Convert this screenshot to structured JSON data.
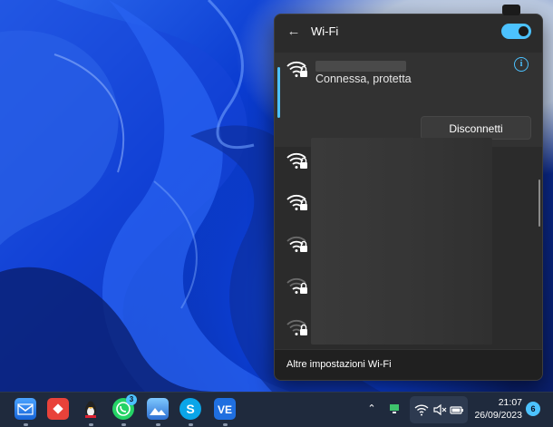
{
  "wifi_panel": {
    "title": "Wi-Fi",
    "toggle_state": "on",
    "connected_network": {
      "status": "Connessa, protetta",
      "action_label": "Disconnetti"
    },
    "available_networks_count": 5,
    "footer_link": "Altre impostazioni Wi-Fi"
  },
  "taskbar": {
    "apps": [
      {
        "name": "mail-app-icon"
      },
      {
        "name": "anydesk-app-icon"
      },
      {
        "name": "tux-app-icon"
      },
      {
        "name": "whatsapp-app-icon",
        "badge": "3"
      },
      {
        "name": "photos-app-icon"
      },
      {
        "name": "skype-app-icon"
      },
      {
        "name": "ve-app-icon",
        "label": "VE"
      }
    ],
    "clock_time": "21:07",
    "clock_date": "26/09/2023",
    "notification_count": "6"
  },
  "colors": {
    "accent": "#4cc2ff",
    "panel_bg": "#2b2b2b",
    "taskbar_bg": "#1f2a3d"
  }
}
